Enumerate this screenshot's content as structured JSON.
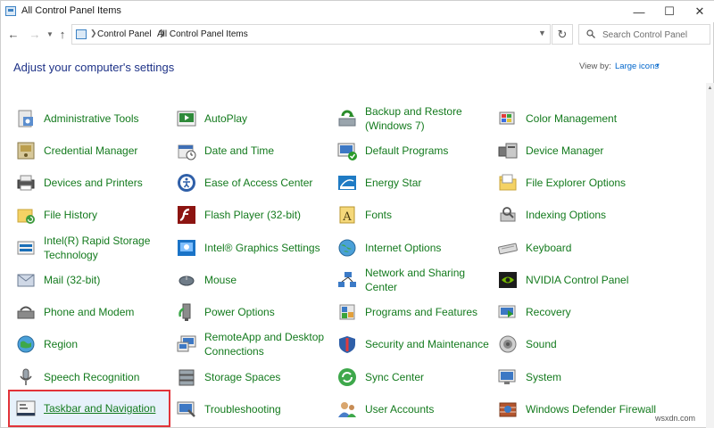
{
  "window": {
    "title": "All Control Panel Items",
    "minimize_glyph": "—",
    "maximize_glyph": "☐",
    "close_glyph": "✕"
  },
  "address": {
    "breadcrumbs": [
      "Control Panel",
      "All Control Panel Items"
    ],
    "search_placeholder": "Search Control Panel"
  },
  "content": {
    "heading": "Adjust your computer's settings",
    "view_by_label": "View by:",
    "view_by_value": "Large icons"
  },
  "items": [
    {
      "label": "Administrative Tools",
      "icon": "administrative-tools-icon"
    },
    {
      "label": "AutoPlay",
      "icon": "autoplay-icon"
    },
    {
      "label": "Backup and Restore (Windows 7)",
      "icon": "backup-restore-icon"
    },
    {
      "label": "Color Management",
      "icon": "color-management-icon"
    },
    {
      "label": "Credential Manager",
      "icon": "credential-manager-icon"
    },
    {
      "label": "Date and Time",
      "icon": "date-time-icon"
    },
    {
      "label": "Default Programs",
      "icon": "default-programs-icon"
    },
    {
      "label": "Device Manager",
      "icon": "device-manager-icon"
    },
    {
      "label": "Devices and Printers",
      "icon": "devices-printers-icon"
    },
    {
      "label": "Ease of Access Center",
      "icon": "ease-of-access-icon"
    },
    {
      "label": "Energy Star",
      "icon": "energy-star-icon"
    },
    {
      "label": "File Explorer Options",
      "icon": "file-explorer-options-icon"
    },
    {
      "label": "File History",
      "icon": "file-history-icon"
    },
    {
      "label": "Flash Player (32-bit)",
      "icon": "flash-player-icon"
    },
    {
      "label": "Fonts",
      "icon": "fonts-icon"
    },
    {
      "label": "Indexing Options",
      "icon": "indexing-options-icon"
    },
    {
      "label": "Intel(R) Rapid Storage Technology",
      "icon": "intel-rapid-storage-icon"
    },
    {
      "label": "Intel® Graphics Settings",
      "icon": "intel-graphics-icon"
    },
    {
      "label": "Internet Options",
      "icon": "internet-options-icon"
    },
    {
      "label": "Keyboard",
      "icon": "keyboard-icon"
    },
    {
      "label": "Mail (32-bit)",
      "icon": "mail-icon"
    },
    {
      "label": "Mouse",
      "icon": "mouse-icon"
    },
    {
      "label": "Network and Sharing Center",
      "icon": "network-sharing-icon"
    },
    {
      "label": "NVIDIA Control Panel",
      "icon": "nvidia-icon"
    },
    {
      "label": "Phone and Modem",
      "icon": "phone-modem-icon"
    },
    {
      "label": "Power Options",
      "icon": "power-options-icon"
    },
    {
      "label": "Programs and Features",
      "icon": "programs-features-icon"
    },
    {
      "label": "Recovery",
      "icon": "recovery-icon"
    },
    {
      "label": "Region",
      "icon": "region-icon"
    },
    {
      "label": "RemoteApp and Desktop Connections",
      "icon": "remoteapp-icon"
    },
    {
      "label": "Security and Maintenance",
      "icon": "security-maintenance-icon"
    },
    {
      "label": "Sound",
      "icon": "sound-icon"
    },
    {
      "label": "Speech Recognition",
      "icon": "speech-recognition-icon"
    },
    {
      "label": "Storage Spaces",
      "icon": "storage-spaces-icon"
    },
    {
      "label": "Sync Center",
      "icon": "sync-center-icon"
    },
    {
      "label": "System",
      "icon": "system-icon"
    },
    {
      "label": "Taskbar and Navigation",
      "icon": "taskbar-navigation-icon",
      "selected": true
    },
    {
      "label": "Troubleshooting",
      "icon": "troubleshooting-icon"
    },
    {
      "label": "User Accounts",
      "icon": "user-accounts-icon"
    },
    {
      "label": "Windows Defender Firewall",
      "icon": "windows-defender-firewall-icon"
    }
  ],
  "colors": {
    "item_text": "#137a1d",
    "heading": "#1e3287",
    "link": "#0066cc",
    "selection_border": "#e23339"
  },
  "watermark": "wsxdn.com"
}
